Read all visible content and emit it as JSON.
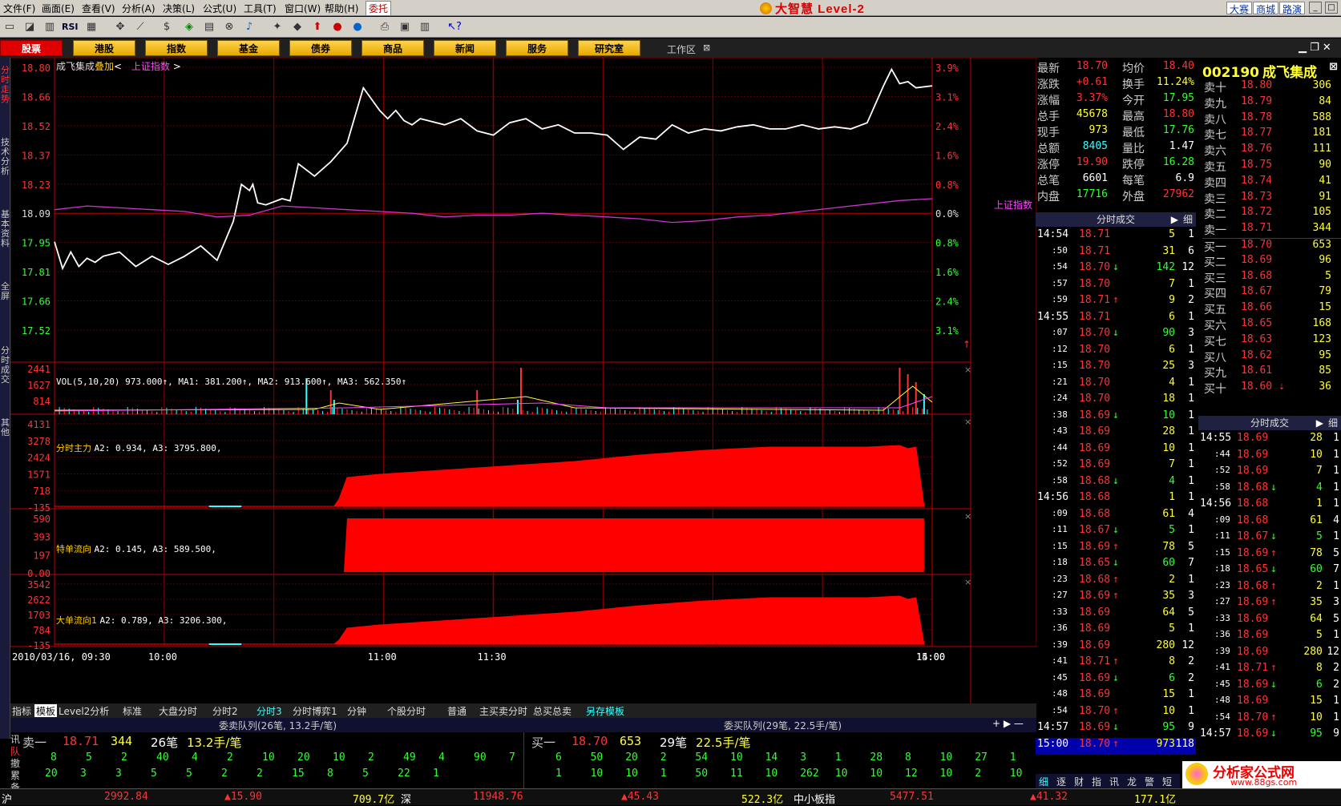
{
  "menu": [
    "文件(F)",
    "画面(E)",
    "查看(V)",
    "分析(A)",
    "决策(L)",
    "公式(U)",
    "工具(T)",
    "窗口(W)",
    "帮助(H)"
  ],
  "menu_extra": "委托",
  "window_title": "大智慧 Level-2",
  "right_buttons": [
    "大赛",
    "商城",
    "路演"
  ],
  "tabs": [
    "股票",
    "港股",
    "指数",
    "基金",
    "债券",
    "商品",
    "新闻",
    "服务",
    "研究室"
  ],
  "workarea": "工作区",
  "left_vtabs": [
    "分时走势",
    "技术分析",
    "基本资料",
    "全屏",
    "分时成交",
    "其他"
  ],
  "chart": {
    "stock_label": "成飞集成",
    "overlay_label": "叠加",
    "index_label": "上证指数",
    "index_tag": "上证指数",
    "price_ticks": [
      "18.80",
      "18.66",
      "18.52",
      "18.37",
      "18.23",
      "18.09",
      "17.95",
      "17.81",
      "17.66",
      "17.52"
    ],
    "pct_ticks": [
      "3.9%",
      "3.1%",
      "2.4%",
      "1.6%",
      "0.8%",
      "0.0%",
      "0.8%",
      "1.6%",
      "2.4%",
      "3.1%"
    ],
    "vol_title": "VOL(5,10,20) 973.000↑, MA1: 381.200↑, MA2: 913.600↑, MA3: 562.350↑",
    "vol_ticks": [
      "2441",
      "1627",
      "814"
    ],
    "p1_title": "分时主力",
    "p1_vals": "A2: 0.934, A3: 3795.800,",
    "p1_ticks": [
      "4131",
      "3278",
      "2424",
      "1571",
      "718",
      "-135"
    ],
    "p2_title": "特单流向",
    "p2_vals": "A2: 0.145, A3: 589.500,",
    "p2_ticks": [
      "590",
      "393",
      "197",
      "0.00"
    ],
    "p3_title": "大单流向1",
    "p3_vals": "A2: 0.789, A3: 3206.300,",
    "p3_ticks": [
      "3542",
      "2622",
      "1703",
      "784",
      "-135"
    ],
    "time_labels": [
      "2010/03/16, 09:30",
      "10:00",
      "11:00",
      "11:30",
      "14:00",
      "15:00"
    ]
  },
  "chart_data": {
    "type": "line",
    "title": "成飞集成",
    "series": [
      {
        "name": "成飞集成",
        "x": [
          0,
          5,
          10,
          15,
          20,
          25,
          30,
          40,
          50,
          60,
          70,
          80,
          90,
          100,
          110,
          115,
          120,
          122,
          125,
          130,
          140,
          145,
          150,
          160,
          170,
          180,
          190,
          200,
          205,
          210,
          215,
          220,
          225,
          230,
          240,
          250,
          260,
          270,
          280,
          290,
          300,
          310,
          320,
          330,
          340,
          350,
          360,
          370,
          380,
          390,
          400,
          410,
          420,
          430,
          440,
          450,
          460,
          470,
          480,
          490,
          500,
          510,
          515,
          520,
          525,
          530,
          540
        ],
        "values": [
          17.95,
          17.82,
          17.9,
          17.83,
          17.87,
          17.85,
          17.88,
          17.9,
          17.83,
          17.88,
          17.84,
          17.88,
          17.93,
          17.86,
          18.05,
          18.23,
          18.2,
          18.23,
          18.14,
          18.13,
          18.16,
          18.15,
          18.33,
          18.27,
          18.34,
          18.43,
          18.7,
          18.59,
          18.55,
          18.59,
          18.54,
          18.52,
          18.55,
          18.54,
          18.52,
          18.55,
          18.49,
          18.47,
          18.53,
          18.55,
          18.5,
          18.52,
          18.48,
          18.48,
          18.47,
          18.4,
          18.46,
          18.45,
          18.52,
          18.48,
          18.5,
          18.49,
          18.51,
          18.52,
          18.5,
          18.5,
          18.52,
          18.5,
          18.51,
          18.5,
          18.53,
          18.71,
          18.79,
          18.72,
          18.73,
          18.7,
          18.71
        ]
      },
      {
        "name": "上证指数",
        "x": [
          0,
          20,
          40,
          60,
          80,
          100,
          120,
          140,
          160,
          180,
          200,
          220,
          240,
          260,
          280,
          300,
          320,
          340,
          360,
          380,
          400,
          420,
          440,
          460,
          480,
          500,
          520,
          540
        ],
        "values": [
          0.1,
          0.2,
          0.15,
          0.1,
          0.05,
          -0.1,
          -0.05,
          0.2,
          0.15,
          0.1,
          0.05,
          0.0,
          -0.1,
          -0.05,
          -0.05,
          0.0,
          -0.05,
          -0.1,
          -0.15,
          -0.25,
          -0.2,
          -0.1,
          -0.05,
          0.05,
          0.15,
          0.25,
          0.35,
          0.4
        ]
      }
    ],
    "xlabel": "",
    "ylabel": "",
    "ylim": [
      17.45,
      18.85
    ]
  },
  "quote": [
    {
      "l1": "最新",
      "v1": "18.70",
      "c1": "red",
      "l2": "均价",
      "v2": "18.40",
      "c2": "red"
    },
    {
      "l1": "涨跌",
      "v1": "+0.61",
      "c1": "red",
      "l2": "换手",
      "v2": "11.24%",
      "c2": "yel"
    },
    {
      "l1": "涨幅",
      "v1": "3.37%",
      "c1": "red",
      "l2": "今开",
      "v2": "17.95",
      "c2": "grn"
    },
    {
      "l1": "总手",
      "v1": "45678",
      "c1": "yel",
      "l2": "最高",
      "v2": "18.80",
      "c2": "red"
    },
    {
      "l1": "现手",
      "v1": "973",
      "c1": "yel",
      "l2": "最低",
      "v2": "17.76",
      "c2": "grn"
    },
    {
      "l1": "总额",
      "v1": "8405",
      "c1": "cyn",
      "l2": "量比",
      "v2": "1.47",
      "c2": "wht"
    },
    {
      "l1": "涨停",
      "v1": "19.90",
      "c1": "red",
      "l2": "跌停",
      "v2": "16.28",
      "c2": "grn"
    },
    {
      "l1": "总笔",
      "v1": "6601",
      "c1": "wht",
      "l2": "每笔",
      "v2": "6.9",
      "c2": "wht"
    },
    {
      "l1": "内盘",
      "v1": "17716",
      "c1": "grn",
      "l2": "外盘",
      "v2": "27962",
      "c2": "red"
    }
  ],
  "stock_code": "002190",
  "stock_name": "成飞集成",
  "orderbook": [
    {
      "l": "卖十",
      "p": "18.80",
      "v": "306"
    },
    {
      "l": "卖九",
      "p": "18.79",
      "v": "84"
    },
    {
      "l": "卖八",
      "p": "18.78",
      "v": "588"
    },
    {
      "l": "卖七",
      "p": "18.77",
      "v": "181"
    },
    {
      "l": "卖六",
      "p": "18.76",
      "v": "111"
    },
    {
      "l": "卖五",
      "p": "18.75",
      "v": "90"
    },
    {
      "l": "卖四",
      "p": "18.74",
      "v": "41"
    },
    {
      "l": "卖三",
      "p": "18.73",
      "v": "91"
    },
    {
      "l": "卖二",
      "p": "18.72",
      "v": "105"
    },
    {
      "l": "卖一",
      "p": "18.71",
      "v": "344"
    },
    {
      "l": "买一",
      "p": "18.70",
      "v": "653"
    },
    {
      "l": "买二",
      "p": "18.69",
      "v": "96"
    },
    {
      "l": "买三",
      "p": "18.68",
      "v": "5"
    },
    {
      "l": "买四",
      "p": "18.67",
      "v": "79"
    },
    {
      "l": "买五",
      "p": "18.66",
      "v": "15"
    },
    {
      "l": "买六",
      "p": "18.65",
      "v": "168"
    },
    {
      "l": "买七",
      "p": "18.63",
      "v": "123"
    },
    {
      "l": "买八",
      "p": "18.62",
      "v": "95"
    },
    {
      "l": "买九",
      "p": "18.61",
      "v": "85"
    },
    {
      "l": "买十",
      "p": "18.60 ⇣",
      "v": "36"
    }
  ],
  "ticks_header": "分时成交",
  "ticks_detail": "细",
  "ticks": [
    {
      "t": "14:54",
      "p": "18.71",
      "a": "",
      "v": "5",
      "n": "1"
    },
    {
      "t": ":50",
      "p": "18.71",
      "a": "",
      "v": "31",
      "n": "6"
    },
    {
      "t": ":54",
      "p": "18.70",
      "a": "↓",
      "v": "142",
      "n": "12"
    },
    {
      "t": ":57",
      "p": "18.70",
      "a": "",
      "v": "7",
      "n": "1"
    },
    {
      "t": ":59",
      "p": "18.71",
      "a": "↑",
      "v": "9",
      "n": "2"
    },
    {
      "t": "14:55",
      "p": "18.71",
      "a": "",
      "v": "6",
      "n": "1"
    },
    {
      "t": ":07",
      "p": "18.70",
      "a": "↓",
      "v": "90",
      "n": "3"
    },
    {
      "t": ":12",
      "p": "18.70",
      "a": "",
      "v": "6",
      "n": "1"
    },
    {
      "t": ":15",
      "p": "18.70",
      "a": "",
      "v": "25",
      "n": "3"
    },
    {
      "t": ":21",
      "p": "18.70",
      "a": "",
      "v": "4",
      "n": "1"
    },
    {
      "t": ":24",
      "p": "18.70",
      "a": "",
      "v": "18",
      "n": "1"
    },
    {
      "t": ":38",
      "p": "18.69",
      "a": "↓",
      "v": "10",
      "n": "1"
    },
    {
      "t": ":43",
      "p": "18.69",
      "a": "",
      "v": "28",
      "n": "1"
    },
    {
      "t": ":44",
      "p": "18.69",
      "a": "",
      "v": "10",
      "n": "1"
    },
    {
      "t": ":52",
      "p": "18.69",
      "a": "",
      "v": "7",
      "n": "1"
    },
    {
      "t": ":58",
      "p": "18.68",
      "a": "↓",
      "v": "4",
      "n": "1"
    },
    {
      "t": "14:56",
      "p": "18.68",
      "a": "",
      "v": "1",
      "n": "1"
    },
    {
      "t": ":09",
      "p": "18.68",
      "a": "",
      "v": "61",
      "n": "4"
    },
    {
      "t": ":11",
      "p": "18.67",
      "a": "↓",
      "v": "5",
      "n": "1"
    },
    {
      "t": ":15",
      "p": "18.69",
      "a": "↑",
      "v": "78",
      "n": "5"
    },
    {
      "t": ":18",
      "p": "18.65",
      "a": "↓",
      "v": "60",
      "n": "7"
    },
    {
      "t": ":23",
      "p": "18.68",
      "a": "↑",
      "v": "2",
      "n": "1"
    },
    {
      "t": ":27",
      "p": "18.69",
      "a": "↑",
      "v": "35",
      "n": "3"
    },
    {
      "t": ":33",
      "p": "18.69",
      "a": "",
      "v": "64",
      "n": "5"
    },
    {
      "t": ":36",
      "p": "18.69",
      "a": "",
      "v": "5",
      "n": "1"
    },
    {
      "t": ":39",
      "p": "18.69",
      "a": "",
      "v": "280",
      "n": "12"
    },
    {
      "t": ":41",
      "p": "18.71",
      "a": "↑",
      "v": "8",
      "n": "2"
    },
    {
      "t": ":45",
      "p": "18.69",
      "a": "↓",
      "v": "6",
      "n": "2"
    },
    {
      "t": ":48",
      "p": "18.69",
      "a": "",
      "v": "15",
      "n": "1"
    },
    {
      "t": ":54",
      "p": "18.70",
      "a": "↑",
      "v": "10",
      "n": "1"
    },
    {
      "t": "14:57",
      "p": "18.69",
      "a": "↓",
      "v": "95",
      "n": "9"
    },
    {
      "t": "15:00",
      "p": "18.70",
      "a": "↑",
      "v": "973",
      "n": "118"
    }
  ],
  "ticks2": [
    {
      "t": "14:55",
      "p": "18.69",
      "a": "",
      "v": "28",
      "n": "1"
    },
    {
      "t": ":44",
      "p": "18.69",
      "a": "",
      "v": "10",
      "n": "1"
    },
    {
      "t": ":52",
      "p": "18.69",
      "a": "",
      "v": "7",
      "n": "1"
    },
    {
      "t": ":58",
      "p": "18.68",
      "a": "↓",
      "v": "4",
      "n": "1"
    },
    {
      "t": "14:56",
      "p": "18.68",
      "a": "",
      "v": "1",
      "n": "1"
    },
    {
      "t": ":09",
      "p": "18.68",
      "a": "",
      "v": "61",
      "n": "4"
    },
    {
      "t": ":11",
      "p": "18.67",
      "a": "↓",
      "v": "5",
      "n": "1"
    },
    {
      "t": ":15",
      "p": "18.69",
      "a": "↑",
      "v": "78",
      "n": "5"
    },
    {
      "t": ":18",
      "p": "18.65",
      "a": "↓",
      "v": "60",
      "n": "7"
    },
    {
      "t": ":23",
      "p": "18.68",
      "a": "↑",
      "v": "2",
      "n": "1"
    },
    {
      "t": ":27",
      "p": "18.69",
      "a": "↑",
      "v": "35",
      "n": "3"
    },
    {
      "t": ":33",
      "p": "18.69",
      "a": "",
      "v": "64",
      "n": "5"
    },
    {
      "t": ":36",
      "p": "18.69",
      "a": "",
      "v": "5",
      "n": "1"
    },
    {
      "t": ":39",
      "p": "18.69",
      "a": "",
      "v": "280",
      "n": "12"
    },
    {
      "t": ":41",
      "p": "18.71",
      "a": "↑",
      "v": "8",
      "n": "2"
    },
    {
      "t": ":45",
      "p": "18.69",
      "a": "↓",
      "v": "6",
      "n": "2"
    },
    {
      "t": ":48",
      "p": "18.69",
      "a": "",
      "v": "15",
      "n": "1"
    },
    {
      "t": ":54",
      "p": "18.70",
      "a": "↑",
      "v": "10",
      "n": "1"
    },
    {
      "t": "14:57",
      "p": "18.69",
      "a": "↓",
      "v": "95",
      "n": "9"
    }
  ],
  "bottom_tabs": [
    "指标",
    "模板",
    "Level2分析",
    "标准",
    "大盘分时",
    "分时2",
    "分时3",
    "分时博弈1",
    "分钟",
    "个股分时",
    "普通",
    "主买卖分时",
    "总买总卖",
    "另存模板"
  ],
  "queue": {
    "left_title": "委卖队列(26笔, 13.2手/笔)",
    "right_title": "委买队列(29笔, 22.5手/笔)",
    "side_labels": [
      "讯",
      "队",
      "撤",
      "累",
      "备"
    ],
    "sell_head": {
      "l": "卖一",
      "p": "18.71",
      "v": "344",
      "b": "26笔",
      "h": "13.2手/笔"
    },
    "buy_head": {
      "l": "买一",
      "p": "18.70",
      "v": "653",
      "b": "29笔",
      "h": "22.5手/笔"
    },
    "sell_r1": [
      "8",
      "5",
      "2",
      "40",
      "4",
      "2",
      "10",
      "20",
      "10",
      "2",
      "49",
      "4",
      "90",
      "7"
    ],
    "sell_r2": [
      "20",
      "3",
      "3",
      "5",
      "5",
      "2",
      "2",
      "15",
      "8",
      "5",
      "22",
      "1"
    ],
    "buy_r1": [
      "6",
      "50",
      "20",
      "2",
      "54",
      "10",
      "14",
      "3",
      "1",
      "28",
      "8",
      "10",
      "27",
      "1"
    ],
    "buy_r2": [
      "1",
      "10",
      "10",
      "1",
      "50",
      "11",
      "10",
      "262",
      "10",
      "10",
      "12",
      "10",
      "2",
      "10"
    ]
  },
  "status": {
    "sh_label": "沪",
    "sh_val": "2992.84",
    "sh_chg": "▲15.90",
    "sh_amt": "709.7亿",
    "sz_label": "深",
    "sz_val": "11948.76",
    "sz_chg": "▲45.43",
    "sz_amt": "522.3亿",
    "zx_label": "中小板指",
    "zx_val": "5477.51",
    "zx_chg": "▲41.32",
    "zx_amt": "177.1亿"
  },
  "bottom_right_tabs": [
    "细",
    "逐",
    "财",
    "指",
    "讯",
    "龙",
    "警",
    "短"
  ],
  "watermark": "分析家公式网",
  "watermark_url": "www.88gs.com"
}
